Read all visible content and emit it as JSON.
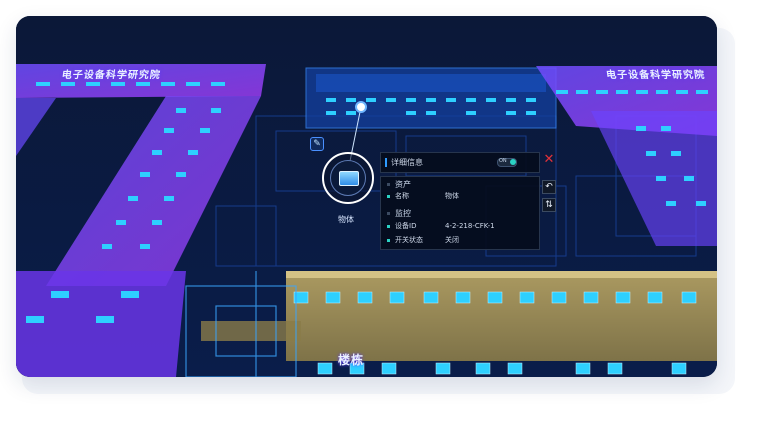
{
  "buildings": {
    "left_label": "电子设备科学研究院",
    "right_label": "电子设备科学研究院",
    "bottom_label": "楼栋"
  },
  "object": {
    "label": "物体",
    "icon": "book-icon"
  },
  "panel": {
    "title": "详细信息",
    "toggle": {
      "text": "ON",
      "state": "on"
    },
    "sections": [
      {
        "name": "资产",
        "rows": [
          {
            "key": "名称",
            "value": "物体"
          }
        ]
      },
      {
        "name": "监控",
        "rows": [
          {
            "key": "设备ID",
            "value": "4-2-218-CFK-1"
          },
          {
            "key": "开关状态",
            "value": "关闭"
          }
        ]
      }
    ]
  },
  "toolbar": {
    "close_icon": "close-icon",
    "back_icon": "undo-icon",
    "swap_icon": "swap-icon",
    "pin_icon": "pin-icon"
  },
  "colors": {
    "purple_building": "#9b4dff",
    "blue_glow": "#1e6fff",
    "window_cyan": "#22c8ff",
    "yellow_building": "#a89a5c",
    "close_red": "#e0313a",
    "toggle_teal": "#2bd3c4"
  }
}
